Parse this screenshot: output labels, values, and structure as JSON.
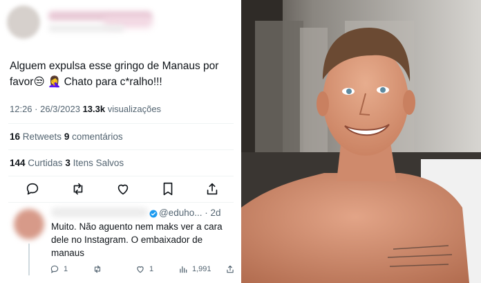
{
  "tweet": {
    "text_line1": "Alguem expulsa esse gringo de Manaus por",
    "text_line2_pre": "favor",
    "emoji_1": "😒",
    "emoji_2": "🤦‍♀️",
    "text_line2_post": " Chato para c*ralho!!!",
    "time": "12:26",
    "separator": " · ",
    "date": "26/3/2023",
    "views_count": "13.3k",
    "views_label": " visualizações",
    "retweets_count": "16",
    "retweets_label": " Retweets ",
    "comments_count": "9",
    "comments_label": " comentários",
    "likes_count": "144",
    "likes_label": " Curtidas ",
    "saved_count": "3",
    "saved_label": " Itens Salvos"
  },
  "reply": {
    "handle": "@eduho...",
    "dot": " · ",
    "age": "2d",
    "text": "Muito. Não aguento nem maks ver a cara dele no Instagram. O embaixador de manaus",
    "reply_count": "1",
    "like_count": "1",
    "view_count": "1,991"
  },
  "photo": {
    "tattoo_line1": "...",
    "icon_hint": "shirtless man selfie"
  },
  "colors": {
    "text_primary": "#0f1419",
    "text_secondary": "#536471",
    "verified": "#1d9bf0",
    "divider": "#eff3f4"
  }
}
